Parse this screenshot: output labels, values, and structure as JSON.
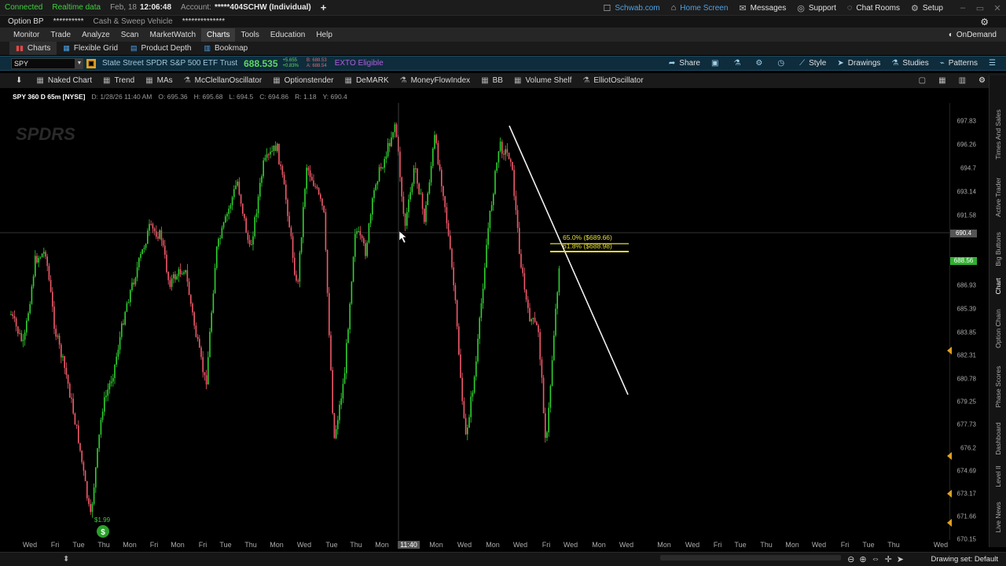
{
  "titlebar": {
    "connected": "Connected",
    "realtime": "Realtime data",
    "date": "Feb, 18",
    "time": "12:06:48",
    "account_label": "Account:",
    "account_value": "*****404SCHW (Individual)",
    "links": [
      {
        "label": "Schwab.com",
        "icon": "globe-icon"
      },
      {
        "label": "Home Screen",
        "icon": "home-icon"
      },
      {
        "label": "Messages",
        "icon": "message-icon"
      },
      {
        "label": "Support",
        "icon": "support-icon"
      },
      {
        "label": "Chat Rooms",
        "icon": "chat-icon"
      },
      {
        "label": "Setup",
        "icon": "gear-icon"
      }
    ]
  },
  "acctbar": {
    "option_bp_label": "Option BP",
    "option_bp_value": "**********",
    "sweep_label": "Cash & Sweep Vehicle",
    "sweep_value": "**************"
  },
  "menu": {
    "items": [
      "Monitor",
      "Trade",
      "Analyze",
      "Scan",
      "MarketWatch",
      "Charts",
      "Tools",
      "Education",
      "Help"
    ],
    "active": "Charts",
    "ondemand": "OnDemand"
  },
  "subtabs": [
    "Charts",
    "Flexible Grid",
    "Product Depth",
    "Bookmap"
  ],
  "symbolbar": {
    "symbol": "SPY",
    "description": "State Street SPDR S&P 500 ETF Trust",
    "price": "688.535",
    "change_top": "+5.655",
    "change_bottom": "+0.83%",
    "bid_top": "B: 688.53",
    "bid_bottom": "A: 688.54",
    "ext": "EXTO Eligible",
    "tools": [
      "Share",
      "Style",
      "Drawings",
      "Studies",
      "Patterns"
    ]
  },
  "studies": [
    "Naked Chart",
    "Trend",
    "MAs",
    "McClellanOscillator",
    "Optionstender",
    "DeMARK",
    "MoneyFlowIndex",
    "BB",
    "Volume Shelf",
    "ElliotOscillator"
  ],
  "infobar": {
    "symbol": "SPY 360 D 65m [NYSE]",
    "d": "D: 1/28/26 11:40 AM",
    "o": "O: 695.36",
    "h": "H: 695.68",
    "l": "L: 694.5",
    "c": "C: 694.86",
    "r": "R: 1.18",
    "y": "Y: 690.4"
  },
  "chart_data": {
    "type": "candlestick",
    "symbol": "SPY",
    "watermark": "SPDRS",
    "y_ticks": [
      "697.83",
      "696.26",
      "694.7",
      "693.14",
      "691.58",
      "690.4",
      "688.56",
      "686.93",
      "685.39",
      "683.85",
      "682.31",
      "680.78",
      "679.25",
      "677.73",
      "676.2",
      "674.69",
      "673.17",
      "671.66",
      "670.15"
    ],
    "ylim": [
      670.15,
      698.5
    ],
    "crosshair_price": "690.4",
    "last_price": "688.56",
    "x_ticks": [
      "Wed",
      "Fri",
      "Tue",
      "Thu",
      "Mon",
      "Fri",
      "Mon",
      "Fri",
      "Tue",
      "Thu",
      "Mon",
      "Wed",
      "Tue",
      "Thu",
      "Mon",
      "11:40",
      "Mon",
      "Wed",
      "Mon",
      "Wed",
      "Fri",
      "Wed",
      "Mon",
      "Wed",
      "Mon",
      "Wed",
      "Fri",
      "Tue",
      "Thu",
      "Mon",
      "Wed",
      "Fri",
      "Tue",
      "Thu",
      "Wed"
    ],
    "fib_labels": [
      "65.0% ($689.66)",
      "61.8% ($688.98)"
    ],
    "buy_signal": "$1.99",
    "buy_marker": "$"
  },
  "sidetabs": [
    "Times And Sales",
    "Active Trader",
    "Big Buttons",
    "Chart",
    "Option Chain",
    "Phase Scores",
    "Dashboard",
    "Level II",
    "Live News"
  ],
  "status": {
    "drawing_set": "Drawing set: Default"
  }
}
